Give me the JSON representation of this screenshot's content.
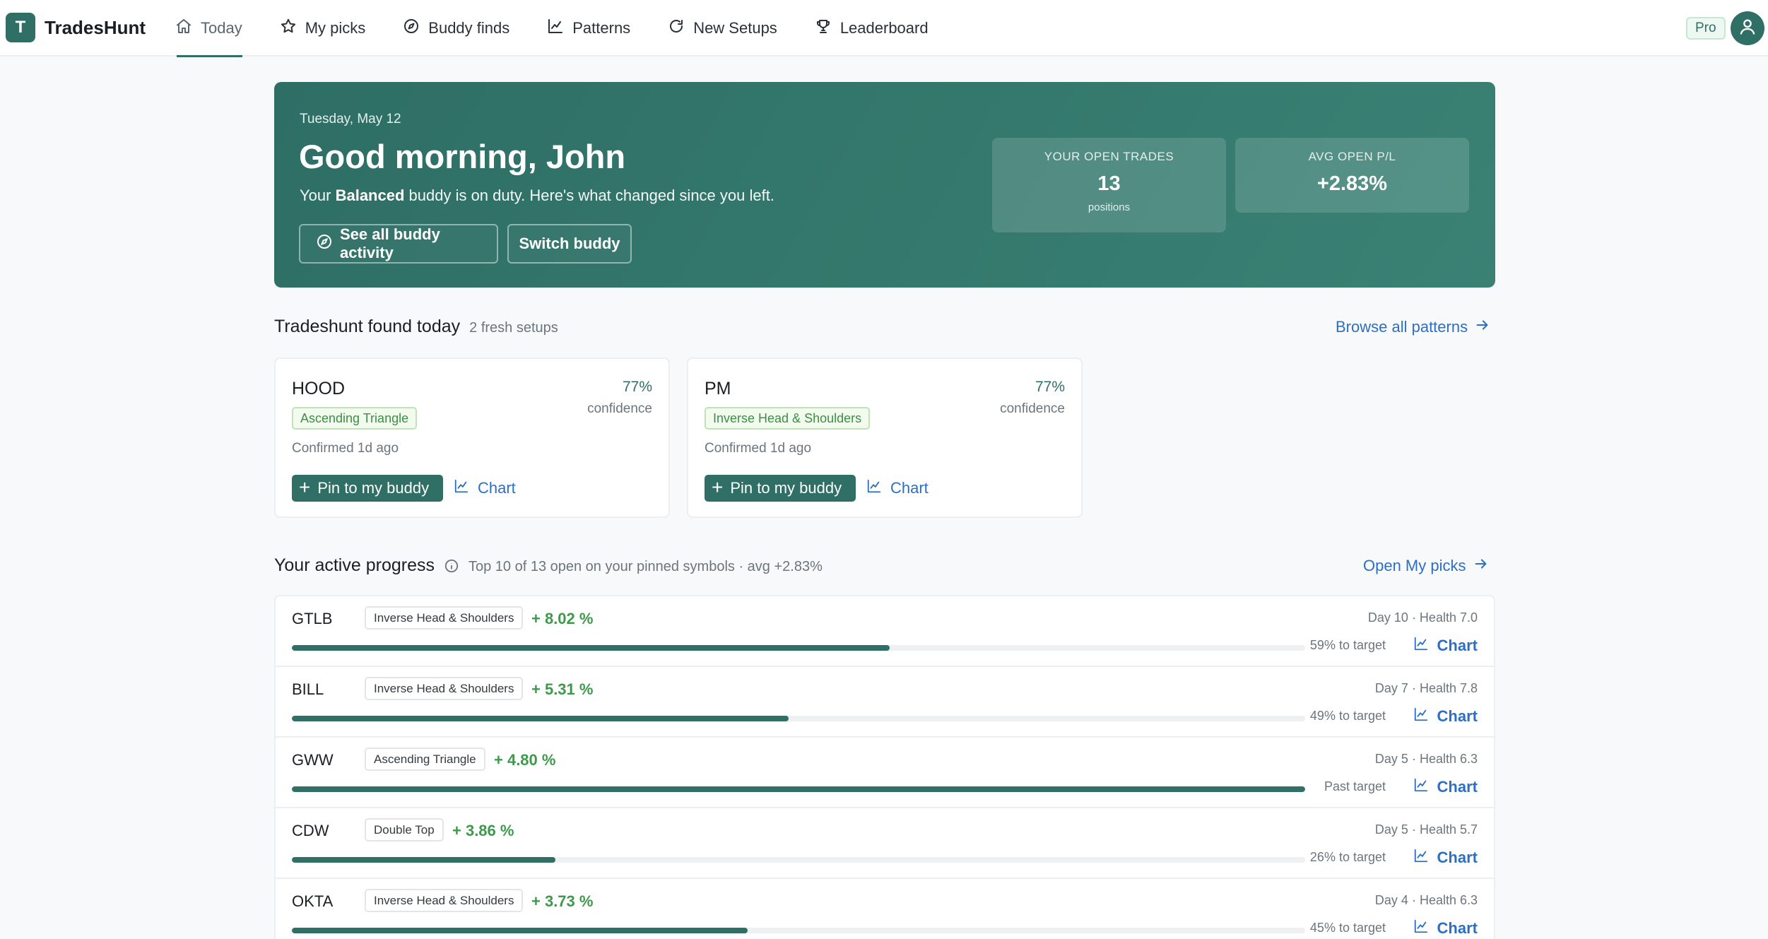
{
  "app": {
    "logo_letter": "T",
    "name": "TradesHunt"
  },
  "nav": [
    {
      "label": "Today",
      "icon": "home-icon",
      "active": true
    },
    {
      "label": "My picks",
      "icon": "star-icon"
    },
    {
      "label": "Buddy finds",
      "icon": "compass-icon"
    },
    {
      "label": "Patterns",
      "icon": "line-chart-icon"
    },
    {
      "label": "New Setups",
      "icon": "refresh-icon"
    },
    {
      "label": "Leaderboard",
      "icon": "trophy-icon"
    }
  ],
  "header": {
    "plan_badge": "Pro",
    "avatar_icon": "user-icon"
  },
  "hero": {
    "date": "Tuesday, May 12",
    "greeting": "Good morning, John",
    "subtitle_pre": "Your ",
    "subtitle_bold": "Balanced",
    "subtitle_post": " buddy is on duty. Here's what changed since you left.",
    "activity_button": "See all buddy activity",
    "switch_button": "Switch buddy",
    "open_trades": {
      "label": "YOUR OPEN TRADES",
      "value": "13",
      "caption": "positions"
    },
    "avg_pl": {
      "label": "AVG OPEN P/L",
      "value": "+2.83%"
    }
  },
  "found_today": {
    "title": "Tradeshunt found today",
    "meta": "2 fresh setups",
    "link": "Browse all patterns",
    "cards": [
      {
        "symbol": "HOOD",
        "confidence": "77%",
        "confidence_label": "confidence",
        "pattern": "Ascending Triangle",
        "confirmed": "Confirmed 1d ago",
        "pin_label": "Pin to my buddy",
        "chart_label": "Chart"
      },
      {
        "symbol": "PM",
        "confidence": "77%",
        "confidence_label": "confidence",
        "pattern": "Inverse Head & Shoulders",
        "confirmed": "Confirmed 1d ago",
        "pin_label": "Pin to my buddy",
        "chart_label": "Chart"
      }
    ]
  },
  "active_progress": {
    "title": "Your active progress",
    "meta": "Top 10 of 13 open on your pinned symbols · avg +2.83%",
    "link": "Open My picks",
    "rows": [
      {
        "symbol": "GTLB",
        "pattern": "Inverse Head & Shoulders",
        "gain": "+ 8.02 %",
        "meta": "Day 10 · Health 7.0",
        "target": "59% to target",
        "progress": 0.59,
        "chart_label": "Chart"
      },
      {
        "symbol": "BILL",
        "pattern": "Inverse Head & Shoulders",
        "gain": "+ 5.31 %",
        "meta": "Day 7 · Health 7.8",
        "target": "49% to target",
        "progress": 0.49,
        "chart_label": "Chart"
      },
      {
        "symbol": "GWW",
        "pattern": "Ascending Triangle",
        "gain": "+ 4.80 %",
        "meta": "Day 5 · Health 6.3",
        "target": "Past target",
        "progress": 1.0,
        "chart_label": "Chart"
      },
      {
        "symbol": "CDW",
        "pattern": "Double Top",
        "gain": "+ 3.86 %",
        "meta": "Day 5 · Health 5.7",
        "target": "26% to target",
        "progress": 0.26,
        "chart_label": "Chart"
      },
      {
        "symbol": "OKTA",
        "pattern": "Inverse Head & Shoulders",
        "gain": "+ 3.73 %",
        "meta": "Day 4 · Health 6.3",
        "target": "45% to target",
        "progress": 0.45,
        "chart_label": "Chart"
      }
    ]
  },
  "colors": {
    "brand": "#2f6f66",
    "link": "#2d6fc3",
    "gain": "#3c9a4a",
    "chip_green": "#3b8f46"
  }
}
